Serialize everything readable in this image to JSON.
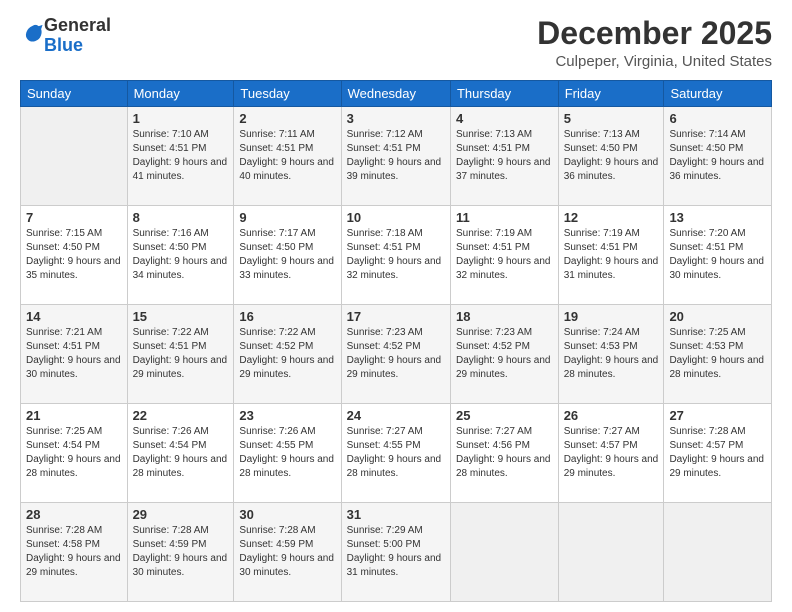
{
  "header": {
    "logo": {
      "line1": "General",
      "line2": "Blue"
    },
    "title": "December 2025",
    "location": "Culpeper, Virginia, United States"
  },
  "weekdays": [
    "Sunday",
    "Monday",
    "Tuesday",
    "Wednesday",
    "Thursday",
    "Friday",
    "Saturday"
  ],
  "weeks": [
    [
      {
        "day": "",
        "sunrise": "",
        "sunset": "",
        "daylight": ""
      },
      {
        "day": "1",
        "sunrise": "Sunrise: 7:10 AM",
        "sunset": "Sunset: 4:51 PM",
        "daylight": "Daylight: 9 hours and 41 minutes."
      },
      {
        "day": "2",
        "sunrise": "Sunrise: 7:11 AM",
        "sunset": "Sunset: 4:51 PM",
        "daylight": "Daylight: 9 hours and 40 minutes."
      },
      {
        "day": "3",
        "sunrise": "Sunrise: 7:12 AM",
        "sunset": "Sunset: 4:51 PM",
        "daylight": "Daylight: 9 hours and 39 minutes."
      },
      {
        "day": "4",
        "sunrise": "Sunrise: 7:13 AM",
        "sunset": "Sunset: 4:51 PM",
        "daylight": "Daylight: 9 hours and 37 minutes."
      },
      {
        "day": "5",
        "sunrise": "Sunrise: 7:13 AM",
        "sunset": "Sunset: 4:50 PM",
        "daylight": "Daylight: 9 hours and 36 minutes."
      },
      {
        "day": "6",
        "sunrise": "Sunrise: 7:14 AM",
        "sunset": "Sunset: 4:50 PM",
        "daylight": "Daylight: 9 hours and 36 minutes."
      }
    ],
    [
      {
        "day": "7",
        "sunrise": "Sunrise: 7:15 AM",
        "sunset": "Sunset: 4:50 PM",
        "daylight": "Daylight: 9 hours and 35 minutes."
      },
      {
        "day": "8",
        "sunrise": "Sunrise: 7:16 AM",
        "sunset": "Sunset: 4:50 PM",
        "daylight": "Daylight: 9 hours and 34 minutes."
      },
      {
        "day": "9",
        "sunrise": "Sunrise: 7:17 AM",
        "sunset": "Sunset: 4:50 PM",
        "daylight": "Daylight: 9 hours and 33 minutes."
      },
      {
        "day": "10",
        "sunrise": "Sunrise: 7:18 AM",
        "sunset": "Sunset: 4:51 PM",
        "daylight": "Daylight: 9 hours and 32 minutes."
      },
      {
        "day": "11",
        "sunrise": "Sunrise: 7:19 AM",
        "sunset": "Sunset: 4:51 PM",
        "daylight": "Daylight: 9 hours and 32 minutes."
      },
      {
        "day": "12",
        "sunrise": "Sunrise: 7:19 AM",
        "sunset": "Sunset: 4:51 PM",
        "daylight": "Daylight: 9 hours and 31 minutes."
      },
      {
        "day": "13",
        "sunrise": "Sunrise: 7:20 AM",
        "sunset": "Sunset: 4:51 PM",
        "daylight": "Daylight: 9 hours and 30 minutes."
      }
    ],
    [
      {
        "day": "14",
        "sunrise": "Sunrise: 7:21 AM",
        "sunset": "Sunset: 4:51 PM",
        "daylight": "Daylight: 9 hours and 30 minutes."
      },
      {
        "day": "15",
        "sunrise": "Sunrise: 7:22 AM",
        "sunset": "Sunset: 4:51 PM",
        "daylight": "Daylight: 9 hours and 29 minutes."
      },
      {
        "day": "16",
        "sunrise": "Sunrise: 7:22 AM",
        "sunset": "Sunset: 4:52 PM",
        "daylight": "Daylight: 9 hours and 29 minutes."
      },
      {
        "day": "17",
        "sunrise": "Sunrise: 7:23 AM",
        "sunset": "Sunset: 4:52 PM",
        "daylight": "Daylight: 9 hours and 29 minutes."
      },
      {
        "day": "18",
        "sunrise": "Sunrise: 7:23 AM",
        "sunset": "Sunset: 4:52 PM",
        "daylight": "Daylight: 9 hours and 29 minutes."
      },
      {
        "day": "19",
        "sunrise": "Sunrise: 7:24 AM",
        "sunset": "Sunset: 4:53 PM",
        "daylight": "Daylight: 9 hours and 28 minutes."
      },
      {
        "day": "20",
        "sunrise": "Sunrise: 7:25 AM",
        "sunset": "Sunset: 4:53 PM",
        "daylight": "Daylight: 9 hours and 28 minutes."
      }
    ],
    [
      {
        "day": "21",
        "sunrise": "Sunrise: 7:25 AM",
        "sunset": "Sunset: 4:54 PM",
        "daylight": "Daylight: 9 hours and 28 minutes."
      },
      {
        "day": "22",
        "sunrise": "Sunrise: 7:26 AM",
        "sunset": "Sunset: 4:54 PM",
        "daylight": "Daylight: 9 hours and 28 minutes."
      },
      {
        "day": "23",
        "sunrise": "Sunrise: 7:26 AM",
        "sunset": "Sunset: 4:55 PM",
        "daylight": "Daylight: 9 hours and 28 minutes."
      },
      {
        "day": "24",
        "sunrise": "Sunrise: 7:27 AM",
        "sunset": "Sunset: 4:55 PM",
        "daylight": "Daylight: 9 hours and 28 minutes."
      },
      {
        "day": "25",
        "sunrise": "Sunrise: 7:27 AM",
        "sunset": "Sunset: 4:56 PM",
        "daylight": "Daylight: 9 hours and 28 minutes."
      },
      {
        "day": "26",
        "sunrise": "Sunrise: 7:27 AM",
        "sunset": "Sunset: 4:57 PM",
        "daylight": "Daylight: 9 hours and 29 minutes."
      },
      {
        "day": "27",
        "sunrise": "Sunrise: 7:28 AM",
        "sunset": "Sunset: 4:57 PM",
        "daylight": "Daylight: 9 hours and 29 minutes."
      }
    ],
    [
      {
        "day": "28",
        "sunrise": "Sunrise: 7:28 AM",
        "sunset": "Sunset: 4:58 PM",
        "daylight": "Daylight: 9 hours and 29 minutes."
      },
      {
        "day": "29",
        "sunrise": "Sunrise: 7:28 AM",
        "sunset": "Sunset: 4:59 PM",
        "daylight": "Daylight: 9 hours and 30 minutes."
      },
      {
        "day": "30",
        "sunrise": "Sunrise: 7:28 AM",
        "sunset": "Sunset: 4:59 PM",
        "daylight": "Daylight: 9 hours and 30 minutes."
      },
      {
        "day": "31",
        "sunrise": "Sunrise: 7:29 AM",
        "sunset": "Sunset: 5:00 PM",
        "daylight": "Daylight: 9 hours and 31 minutes."
      },
      {
        "day": "",
        "sunrise": "",
        "sunset": "",
        "daylight": ""
      },
      {
        "day": "",
        "sunrise": "",
        "sunset": "",
        "daylight": ""
      },
      {
        "day": "",
        "sunrise": "",
        "sunset": "",
        "daylight": ""
      }
    ]
  ]
}
